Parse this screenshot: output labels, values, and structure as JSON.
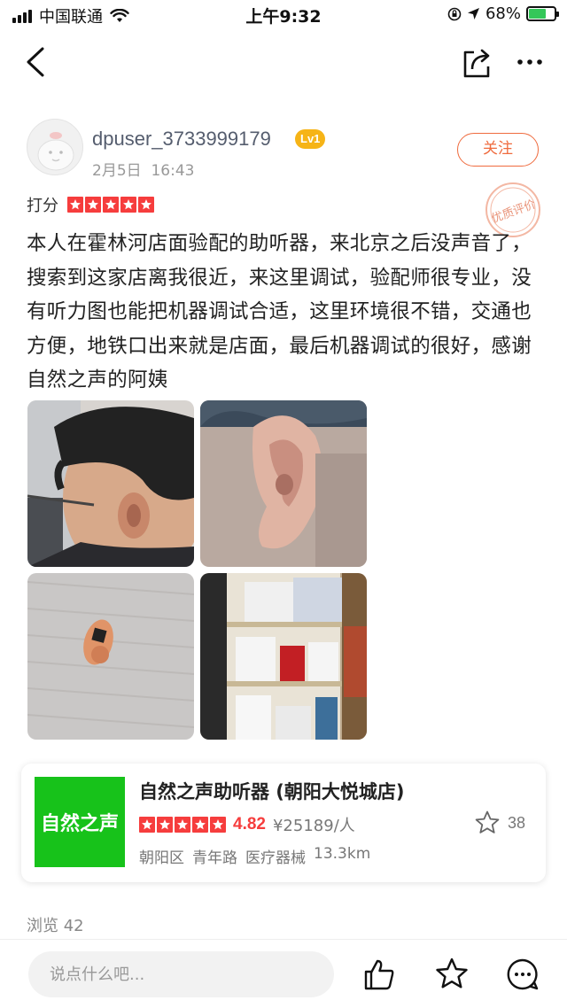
{
  "status_bar": {
    "carrier": "中国联通",
    "time": "上午9:32",
    "battery": "68%",
    "battery_level": 0.68
  },
  "nav": {
    "back_icon": "chevron-left-icon",
    "share_icon": "share-icon",
    "more_icon": "more-icon"
  },
  "author": {
    "name": "dpuser_3733999179",
    "level": "Lv1",
    "date": "2月5日",
    "time": "16:43",
    "follow_label": "关注",
    "stamp_text": "优质评价"
  },
  "rating": {
    "label": "打分",
    "stars": 5
  },
  "review": {
    "text": "本人在霍林河店面验配的助听器，来北京之后没声音了，搜索到这家店离我很近，来这里调试，验配师很专业，没有听力图也能把机器调试合适，这里环境很不错，交通也方便，地铁口出来就是店面，最后机器调试的很好，感谢自然之声的阿姨"
  },
  "photos": [
    {
      "subject": "man-with-glasses-photo"
    },
    {
      "subject": "ear-closeup-photo"
    },
    {
      "subject": "hearing-aid-device-photo"
    },
    {
      "subject": "store-shelf-photo"
    }
  ],
  "shop": {
    "logo_text": "自然之声",
    "name": "自然之声助听器 (朝阳大悦城店)",
    "stars": 5,
    "score": "4.82",
    "price": "¥25189/人",
    "district": "朝阳区",
    "street": "青年路",
    "category": "医疗器械",
    "distance": "13.3km",
    "fav_count": "38"
  },
  "views": {
    "label": "浏览",
    "count": "42"
  },
  "bottom_bar": {
    "comment_placeholder": "说点什么吧..."
  },
  "colors": {
    "star_red": "#f63d3d",
    "follow_orange": "#ef6b3e",
    "logo_green": "#17c21a",
    "level_yellow": "#f6b417",
    "battery_green": "#34c759"
  }
}
